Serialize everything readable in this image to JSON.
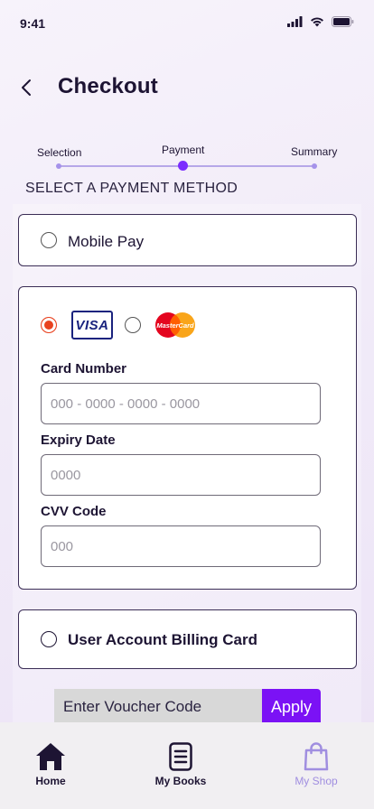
{
  "status_bar": {
    "time": "9:41"
  },
  "header": {
    "title": "Checkout"
  },
  "stepper": {
    "steps": [
      {
        "label": "Selection",
        "active": false
      },
      {
        "label": "Payment",
        "active": true
      },
      {
        "label": "Summary",
        "active": false
      }
    ]
  },
  "payment": {
    "heading": "SELECT A PAYMENT METHOD",
    "mobile_pay": {
      "label": "Mobile Pay",
      "selected": false
    },
    "card": {
      "selected": true,
      "brands": [
        {
          "name": "VISA",
          "selected": true
        },
        {
          "name": "MasterCard",
          "selected": false
        }
      ],
      "fields": {
        "card_number": {
          "label": "Card Number",
          "placeholder": "000 - 0000 - 0000 - 0000",
          "value": ""
        },
        "expiry_date": {
          "label": "Expiry Date",
          "placeholder": "0000",
          "value": ""
        },
        "cvv": {
          "label": "CVV Code",
          "placeholder": "000",
          "value": ""
        }
      }
    },
    "billing_card": {
      "label": "User Account Billing Card",
      "selected": false
    }
  },
  "voucher": {
    "placeholder": "Enter Voucher Code",
    "apply_label": "Apply"
  },
  "bottom_nav": {
    "items": [
      {
        "label": "Home",
        "icon": "home-icon",
        "active": true
      },
      {
        "label": "My Books",
        "icon": "books-icon",
        "active": true
      },
      {
        "label": "My Shop",
        "icon": "shopping-bag-icon",
        "active": false
      }
    ]
  },
  "colors": {
    "accent": "#7b12f5",
    "step_active": "#7b2cff",
    "step_inactive": "#a592ea",
    "radio_selected": "#e8421f",
    "text_dark": "#1d1433",
    "nav_inactive": "#a08ee0"
  }
}
